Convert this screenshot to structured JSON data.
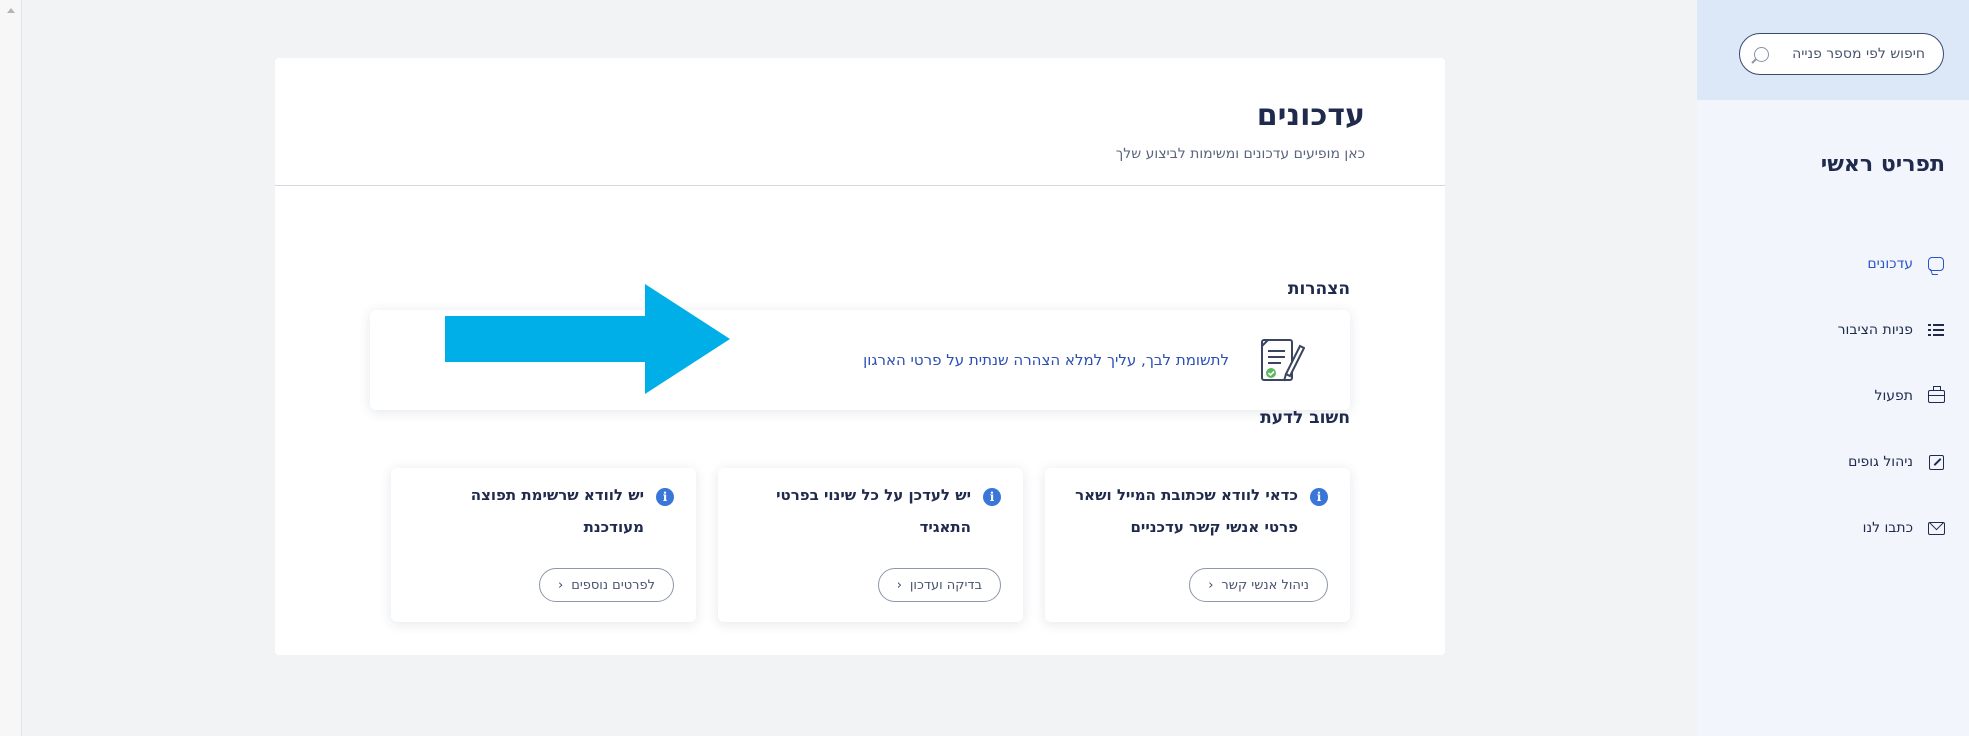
{
  "sidebar": {
    "search_placeholder": "חיפוש לפי מספר פנייה",
    "menu_title": "תפריט ראשי",
    "items": [
      {
        "label": "עדכונים",
        "icon": "chat-bubble-icon"
      },
      {
        "label": "פניות הציבור",
        "icon": "list-icon"
      },
      {
        "label": "תפעול",
        "icon": "briefcase-icon"
      },
      {
        "label": "ניהול גופים",
        "icon": "edit-icon"
      },
      {
        "label": "כתבו לנו",
        "icon": "mail-icon"
      }
    ]
  },
  "main": {
    "title": "עדכונים",
    "subtitle": "כאן מופיעים עדכונים ומשימות לביצוע שלך",
    "declarations": {
      "heading": "הצהרות",
      "link_text": "לתשומת לבך, עליך למלא הצהרה שנתית על פרטי הארגון"
    },
    "important": {
      "heading": "חשוב לדעת",
      "cards": [
        {
          "text": "כדאי לוודא שכתובת המייל ושאר פרטי אנשי קשר עדכניים",
          "button": "ניהול אנשי קשר"
        },
        {
          "text": "יש לעדכן על כל שינוי בפרטי התאגיד",
          "button": "בדיקה ועדכון"
        },
        {
          "text": "יש לוודא שרשימת תפוצה מעודכנת",
          "button": "לפרטים נוספים"
        }
      ]
    }
  },
  "colors": {
    "accent": "#2a55c4",
    "arrow": "#00aee8",
    "info": "#3a76d8",
    "sidebar_top": "#dce8f8"
  }
}
